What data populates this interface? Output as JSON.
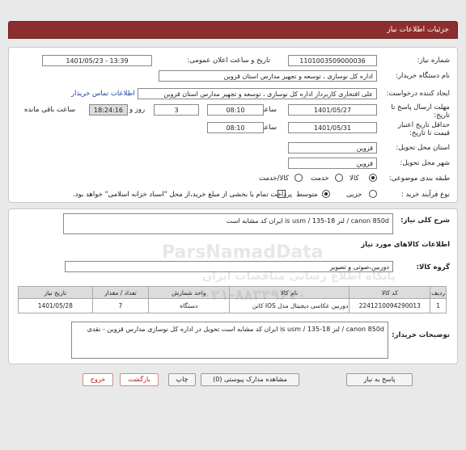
{
  "header": {
    "title": "جزئیات اطلاعات نیاز"
  },
  "form": {
    "need_number": {
      "label": "شماره نیاز:",
      "value": "1101003509000036"
    },
    "announce_date": {
      "label": "تاریخ و ساعت اعلان عمومی:",
      "value": "1401/05/23 - 13:39"
    },
    "buyer_org": {
      "label": "نام دستگاه خریدار:",
      "value": "اداره کل نوسازی ، توسعه و تجهیز مدارس استان قزوین"
    },
    "requester": {
      "label": "ایجاد کننده درخواست:",
      "value": "علی افتخاری کاربرداز اداره کل نوسازی ، توسعه و تجهیز مدارس استان قزوین",
      "contact_link": "اطلاعات تماس خریدار"
    },
    "deadline": {
      "label": "مهلت ارسال پاسخ تا تاریخ:",
      "date": "1401/05/27",
      "time_label": "ساعت",
      "time": "08:10",
      "days": "3",
      "days_label": "روز و",
      "remaining": "18:24:16",
      "remaining_label": "ساعت باقی مانده"
    },
    "validity": {
      "label": "حداقل تاریخ اعتبار قیمت تا تاریخ:",
      "date": "1401/05/31",
      "time_label": "ساعت",
      "time": "08:10"
    },
    "province": {
      "label": "استان محل تحویل:",
      "value": "قزوین"
    },
    "city": {
      "label": "شهر محل تحویل:",
      "value": "قزوین"
    },
    "category": {
      "label": "طبقه بندی موضوعی:",
      "options": [
        "کالا",
        "خدمت",
        "کالا/خدمت"
      ]
    },
    "process": {
      "label": "نوع فرآیند خرید :",
      "options": [
        "جزیی",
        "متوسط"
      ],
      "note": "پرداخت تمام یا بخشی از مبلغ خرید،از محل \"اسناد خزانه اسلامی\" خواهد بود."
    }
  },
  "summary": {
    "label": "شرح کلی نیاز:",
    "value": "canon 850d / لنز 18-135 / is usm  ایران کد مشابه است"
  },
  "goods": {
    "title": "اطلاعات کالاهای مورد نیاز",
    "group_label": "گروه کالا:",
    "group_value": "دوربین،صوتی و تصویر",
    "columns": [
      "ردیف",
      "کد کالا",
      "نام کالا",
      "واحد شمارش",
      "تعداد / مقدار",
      "تاریخ نیاز"
    ],
    "rows": [
      [
        "1",
        "2241210094290013",
        "دوربین عکاسی دیجیتال مدل IOS کانن",
        "دستگاه",
        "7",
        "1401/05/28"
      ]
    ],
    "notes_label": "توضیحات خریدار:",
    "notes": "canon 850d / لنز 18-135 / is usm  ایران کد مشابه است تحویل در اداره کل نوسازی مدارس قزوین - نقدی"
  },
  "buttons": {
    "reply": "پاسخ به نیاز",
    "attachments": "مشاهده مدارک پیوستی (0)",
    "print": "چاپ",
    "back": "بازگشت",
    "exit": "خروج"
  },
  "watermark": {
    "brand": "ParsNamadData",
    "fa": "پایگاه اطلاع رسانی مناقصات ایران",
    "phone": "۰۲۱-۸۸۳۴۹۶۷۰"
  },
  "colors": {
    "header": "#8c2d2e",
    "link": "#1b3f99"
  }
}
